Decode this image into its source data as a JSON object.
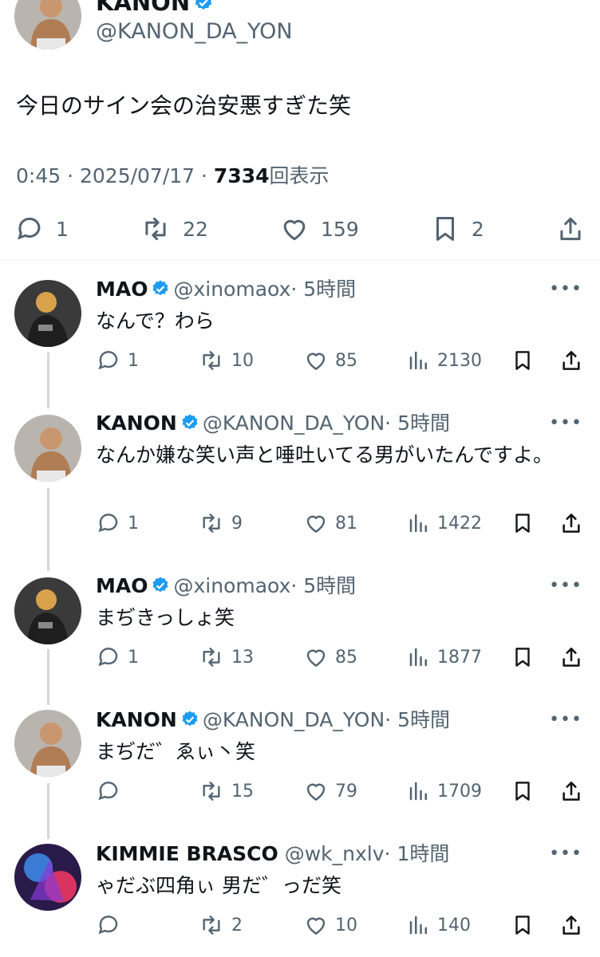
{
  "main": {
    "author_name": "KANON",
    "author_handle": "@KANON_DA_YON",
    "text": "今日のサイン会の治安悪すぎた笑",
    "time": "0:45 · 2025/07/17 · ",
    "views": "7334",
    "views_label": "回表示",
    "replies": "1",
    "reposts": "22",
    "likes": "159",
    "bookmarks": "2"
  },
  "replies": [
    {
      "name": "MAO",
      "handle": "@xinomaox",
      "time": "· 5時間",
      "text": "なんで？わら",
      "reply_count": "1",
      "reposts": "10",
      "likes": "85",
      "views": "2130"
    },
    {
      "name": "KANON",
      "handle": "@KANON_DA_YON",
      "time": "· 5時間",
      "text": "なんか嫌な笑い声と唾吐いてる男がいたんですよ。",
      "reply_count": "1",
      "reposts": "9",
      "likes": "81",
      "views": "1422"
    },
    {
      "name": "MAO",
      "handle": "@xinomaox",
      "time": "· 5時間",
      "text": "まぢきっしょ笑",
      "reply_count": "1",
      "reposts": "13",
      "likes": "85",
      "views": "1877"
    },
    {
      "name": "KANON",
      "handle": "@KANON_DA_YON",
      "time": "· 5時間",
      "text": "まぢだ゛ゑぃ丶笑",
      "reply_count": "",
      "reposts": "15",
      "likes": "79",
      "views": "1709"
    },
    {
      "name": "KIMMIE BRASCO",
      "handle": "@wk_nxlv",
      "time": "· 1時間",
      "text": "ゃだぶ四角ぃ 男だ゛っだ笑",
      "reply_count": "",
      "reposts": "2",
      "likes": "10",
      "views": "140"
    }
  ],
  "colors": {
    "verified": "#1d9bf0",
    "secondary": "#536471",
    "divider": "#eff3f4",
    "thread_line": "#cfd9de"
  },
  "icons": [
    "reply-icon",
    "repost-icon",
    "like-icon",
    "views-icon",
    "bookmark-icon",
    "share-icon",
    "more-icon",
    "verified-badge-icon"
  ]
}
